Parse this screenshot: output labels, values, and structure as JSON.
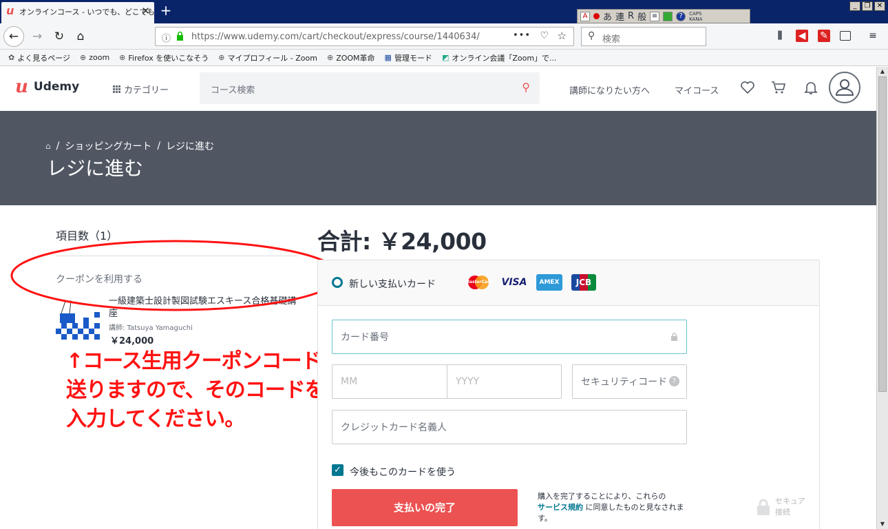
{
  "browser": {
    "tab_title": "オンラインコース - いつでも、どこでも",
    "tab_close": "✕",
    "new_tab": "+",
    "url": "https://www.udemy.com/cart/checkout/express/course/1440634/",
    "search_placeholder": "検索",
    "ime": {
      "items": [
        "あ",
        "連",
        "R",
        "般"
      ],
      "caps": "CAPS",
      "kana": "KANA"
    },
    "bookmarks": [
      "よく見るページ",
      "zoom",
      "Firefox を使いこなそう",
      "マイプロフィール - Zoom",
      "ZOOM革命",
      "管理モード",
      "オンライン会議「Zoom」で..."
    ]
  },
  "header": {
    "logo_text": "Udemy",
    "categories": "カテゴリー",
    "search_placeholder": "コース検索",
    "teach": "講師になりたい方へ",
    "my_courses": "マイコース"
  },
  "hero": {
    "breadcrumb": [
      "ショッピングカート",
      "レジに進む"
    ],
    "separator": "/",
    "title": "レジに進む"
  },
  "cart": {
    "items_count": "項目数（1）",
    "coupon": "クーポンを利用する",
    "course": {
      "title": "一級建築士設計製図試験エスキース合格基礎講座",
      "instructor": "講師: Tatsuya Yamaguchi",
      "price": "￥24,000"
    }
  },
  "annotation": {
    "lines": [
      "↑コース生用クーポンコードを",
      "送りますので、そのコードを",
      "入力してください。"
    ],
    "color": "#ff1212"
  },
  "checkout": {
    "total": "合計: ￥24,000",
    "new_card": "新しい支払いカード",
    "card_brands": [
      "MasterCard",
      "VISA",
      "AMEX",
      "JCB"
    ],
    "card_number_placeholder": "カード番号",
    "mm_placeholder": "MM",
    "yyyy_placeholder": "YYYY",
    "cvc_placeholder": "セキュリティコード",
    "name_placeholder": "クレジットカード名義人",
    "save_card": "今後もこのカードを使う",
    "pay_button": "支払いの完了",
    "terms_prefix": "購入を完了することにより、これらの",
    "terms_link": "サービス規約",
    "terms_suffix": "に同意したものと見なされます。",
    "secure": "セキュア接続"
  },
  "colors": {
    "brand": "#ec5252",
    "hero": "#505763",
    "link": "#007791"
  }
}
